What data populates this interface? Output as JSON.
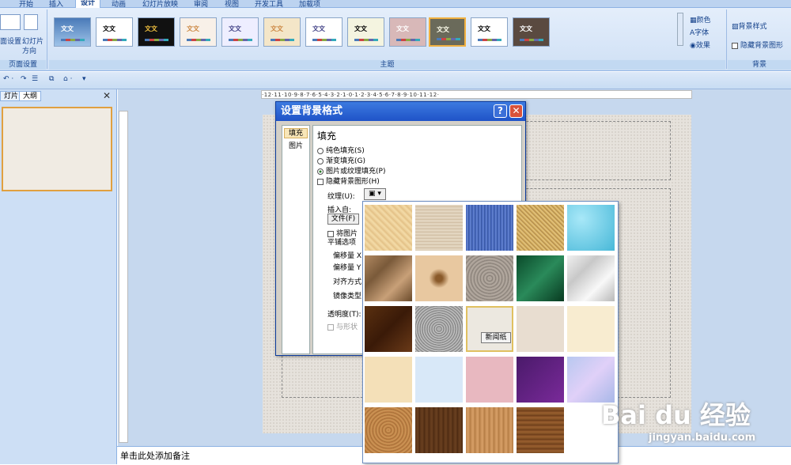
{
  "ribbon_tabs": [
    "开始",
    "插入",
    "设计",
    "动画",
    "幻灯片放映",
    "审阅",
    "视图",
    "开发工具",
    "加载项"
  ],
  "active_tab": "设计",
  "page_setup": {
    "btn1": "面设置",
    "btn2": "幻灯片",
    "btn3": "方向",
    "group": "页面设置"
  },
  "themes": {
    "group": "主题",
    "thumb_text": "文文",
    "count": 11
  },
  "theme_side": {
    "colors": "颜色",
    "fonts": "字体",
    "effects": "效果"
  },
  "background": {
    "style": "背景样式",
    "hide": "隐藏背景图形",
    "group": "背景"
  },
  "left_tabs": [
    "灯片",
    "大纲"
  ],
  "dialog": {
    "title": "设置背景格式",
    "help": "?",
    "close": "✕",
    "side_items": [
      "填充",
      "图片"
    ],
    "section": "填充",
    "options": [
      "纯色填充(S)",
      "渐变填充(G)",
      "图片或纹理填充(P)"
    ],
    "hide_bg": "隐藏背景图形(H)",
    "texture_label": "纹理(U):",
    "insert_from": "插入自:",
    "file_btn": "文件(F)",
    "tile_chk": "将图片",
    "tile_opts": "平铺选项",
    "offset_x": "偏移量 X",
    "offset_y": "偏移量 Y",
    "align": "对齐方式",
    "mirror": "镜像类型",
    "transparency": "透明度(T):",
    "rotate": "与形状"
  },
  "tooltip": "新闻纸",
  "notes": "单击此处添加备注",
  "watermark": {
    "brand": "Bai du 经验",
    "url": "jingyan.baidu.com"
  }
}
